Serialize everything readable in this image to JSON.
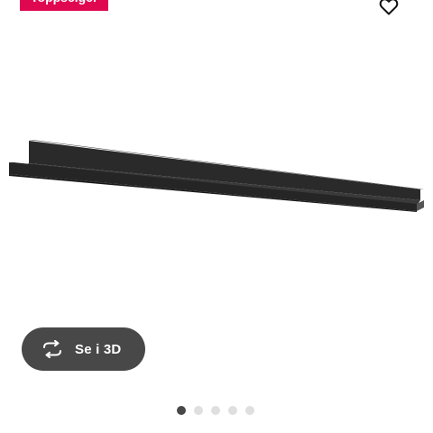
{
  "badge": {
    "label": "Toppselger",
    "color": "#e00751"
  },
  "favorite": {
    "icon": "heart-outline-icon"
  },
  "product_image": {
    "subject": "black picture ledge shelf",
    "color": "#2b2b2b"
  },
  "view3d": {
    "label": "Se i 3D",
    "icon": "rotate-3d-icon"
  },
  "carousel": {
    "active_index": 0,
    "count": 5
  }
}
